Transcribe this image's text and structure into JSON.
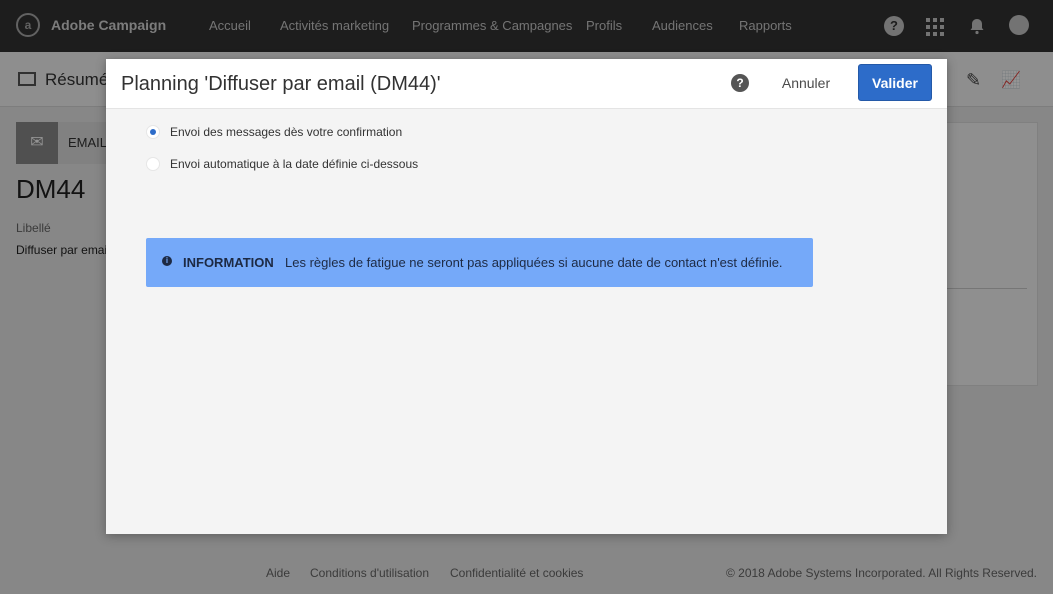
{
  "topbar": {
    "brand": "Adobe Campaign",
    "nav": [
      "Accueil",
      "Activités marketing",
      "Programmes & Campagnes",
      "Profils",
      "Audiences",
      "Rapports"
    ],
    "icons": [
      "help-icon",
      "apps-grid-icon",
      "bell-icon",
      "avatar-icon"
    ]
  },
  "background": {
    "summary_title": "Résumé",
    "channel_label": "EMAIL",
    "code": "DM44",
    "libelle_label": "Libellé",
    "libelle_value": "Diffuser par email",
    "footer": {
      "help": "Aide",
      "terms": "Conditions d'utilisation",
      "privacy": "Confidentialité et cookies",
      "copyright": "© 2018 Adobe Systems Incorporated. All Rights Reserved."
    }
  },
  "modal": {
    "title": "Planning 'Diffuser par email (DM44)'",
    "cancel_label": "Annuler",
    "validate_label": "Valider",
    "options": [
      {
        "label": "Envoi des messages dès votre confirmation",
        "selected": true
      },
      {
        "label": "Envoi automatique à la date définie ci-dessous",
        "selected": false
      }
    ],
    "info": {
      "title": "INFORMATION",
      "text": "Les règles de fatigue ne seront pas appliquées si aucune date de contact n'est définie."
    }
  },
  "colors": {
    "accent": "#2d6cc9",
    "info_bg": "#75a9f9",
    "topbar_bg": "#323232"
  }
}
